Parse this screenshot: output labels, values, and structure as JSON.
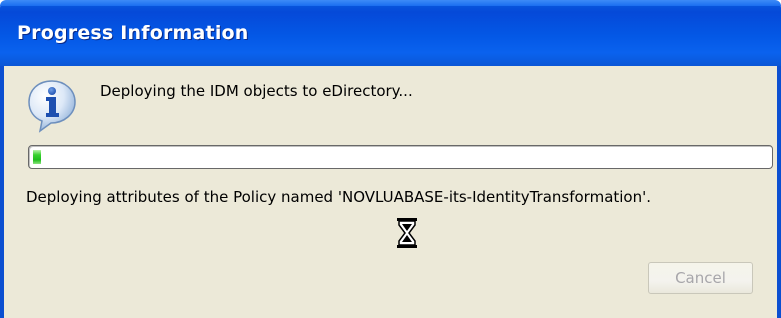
{
  "window": {
    "title": "Progress Information"
  },
  "dialog": {
    "icon": "info-icon",
    "message": "Deploying the IDM objects to eDirectory...",
    "progress_fraction": 0.01,
    "detail": "Deploying attributes of the Policy named 'NOVLUABASE-its-IdentityTransformation'.",
    "cursor": "hourglass-icon"
  },
  "buttons": {
    "cancel_label": "Cancel",
    "cancel_enabled": false
  },
  "colors": {
    "titlebar": "#0458e6",
    "client_bg": "#ece9d8",
    "progress_green": "#1fbe1b"
  }
}
